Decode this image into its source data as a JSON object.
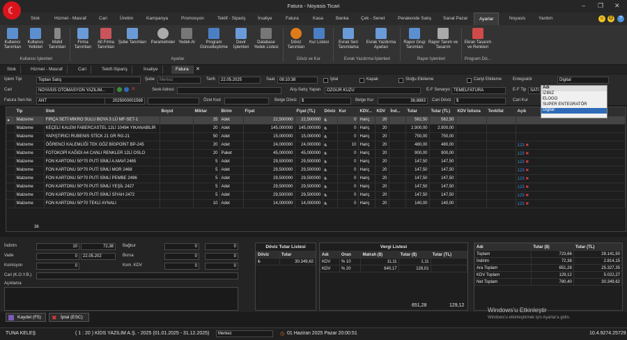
{
  "window": {
    "title": "Fatura - Noyasis Ticari"
  },
  "menu": [
    "Stok",
    "Hizmet - Masraf",
    "Cari",
    "Üretim",
    "Kampanya",
    "Promosyon",
    "Teklif - Sipariş",
    "İrsaliye",
    "Fatura",
    "Kasa",
    "Banka",
    "Çek - Senet",
    "Perakende Satış",
    "Sanal Pazar",
    "Ayarlar",
    "Noyasis",
    "Yardım"
  ],
  "ribbon": {
    "buttons": [
      "Kullanıcı Tanımları",
      "Kullanıcı Yetkileri",
      "Mobil Tanımları",
      "Firma Tanımları",
      "Alt Firma Tanımları",
      "Şube Tanımları",
      "Parametreler",
      "Yedek Al",
      "Program Güncelleştirme",
      "Devir İşlemleri",
      "Database Yedek Listesi",
      "Döviz Tanımları",
      "Kur Listesi",
      "Evrak Seri Tanımlama",
      "Evrak Yazdırma Ayarları",
      "Rapor Grup Tanımları",
      "Rapor Tanım ve Tasarım",
      "Ekran Tasarım ve Renkleri"
    ],
    "groups": [
      "Kullanıcı İşlemleri",
      "Ayarlar",
      "Döviz ve Kur",
      "Evrak Yazdırma İşlemleri",
      "Rapor İşlemleri",
      "Program Diz..."
    ]
  },
  "doc_tabs": [
    "Stok",
    "Hizmet - Masraf",
    "Cari",
    "Teklif-Sipariş",
    "İrsaliye",
    "Fatura"
  ],
  "form": {
    "islem_tipi_label": "İşlem Tipi",
    "islem_tipi": "Toptan Satış",
    "sube_label": "Şube",
    "sube": "Merkez",
    "tarih_label": "Tarih",
    "tarih": "22.05.2025",
    "saat_label": "Saat",
    "saat": "08:10:38",
    "iptal": "İptal",
    "kapak": "Kapak",
    "stoga": "Stoğu Etkileme",
    "cariyi": "Cariyi Etkileme",
    "entegrator_label": "Entegratör",
    "entegrator": "Digital",
    "cari_label": "Cari",
    "cari": "NOYASIS OTOMASYON YAZILIM...",
    "sevk_label": "Sevk Adresi",
    "als_label": "Alış-Satış Yapan",
    "als": "ÖZGÜR KUZU",
    "senaryo_label": "E-F Senaryo",
    "senaryo": "TEMELFATURA",
    "eftip_label": "E-F Tip",
    "eftip": "SATI",
    "seri_label": "Fatura Seri-No",
    "seri": "ANT",
    "no": "2025000001568",
    "ozel_label": "Özel Kod",
    "belge_doviz_label": "Belge Döviz",
    "belge_doviz": "$",
    "belge_kur_label": "Belge Kur",
    "belge_kur": "38,8883",
    "cari_doviz_label": "Cari Döviz",
    "cari_doviz": "$",
    "cari_kur_label": "Cari Kur"
  },
  "dropdown": {
    "header": "Adı",
    "items": [
      "İZIBIZ",
      "ELOGO",
      "SUPER ENTEGRATÖR",
      "Digital"
    ],
    "selected": "Digital"
  },
  "grid": {
    "columns": [
      "Tip",
      "Stok",
      "Boyut",
      "Miktar",
      "Birim",
      "Fiyat",
      "Fiyat (TL)",
      "Döviz",
      "Kur",
      "KDV...",
      "KDV",
      "İnd...",
      "Tutar",
      "Tutar (TL)",
      "KDV İstisna",
      "Tevkifat",
      "Açık"
    ],
    "rows": [
      [
        "Malzeme",
        "FIRÇA SETİ MİKRO SULU BOYA 3 LÜ MF-SET-1",
        "",
        "25",
        "Adet",
        "22,500000",
        "22,500000",
        "₺",
        "0",
        "Hariç",
        "20",
        "",
        "562,50",
        "562,50"
      ],
      [
        "Malzeme",
        "KEÇELİ KALEM FABERCASTEL 12Lİ 10494 YIKANABİLİR",
        "",
        "20",
        "Adet",
        "145,000000",
        "145,000000",
        "₺",
        "0",
        "Hariç",
        "20",
        "",
        "2.900,00",
        "2.900,00"
      ],
      [
        "Malzeme",
        "YAPIŞTIRICI RUBENIS STİCK 21 GR RG-21",
        "",
        "50",
        "Adet",
        "15,000000",
        "15,000000",
        "₺",
        "0",
        "Hariç",
        "20",
        "",
        "750,00",
        "750,00"
      ],
      [
        "Malzeme",
        "ÖĞRENCİ KALEMLİĞİ TEK GÖZ BİGPOİNT BP-245",
        "",
        "20",
        "Adet",
        "24,000000",
        "24,000000",
        "₺",
        "10",
        "Hariç",
        "20",
        "",
        "480,00",
        "480,00"
      ],
      [
        "Malzeme",
        "FOTOKOPİ KAĞIDI A4 CANLI RENKLER 12Lİ OSLO",
        "",
        "20",
        "Paket",
        "45,000000",
        "45,000000",
        "₺",
        "0",
        "Hariç",
        "20",
        "",
        "900,00",
        "900,00"
      ],
      [
        "Malzeme",
        "FON KARTONU 50*70 PUTİ SİMLİ A.MAVİ 2465",
        "",
        "5",
        "Adet",
        "29,500000",
        "29,500000",
        "₺",
        "0",
        "Hariç",
        "20",
        "",
        "147,50",
        "147,50"
      ],
      [
        "Malzeme",
        "FON KARTONU 50*70 PUTİ SİMLİ MOR 2468",
        "",
        "5",
        "Adet",
        "29,500000",
        "29,500000",
        "₺",
        "0",
        "Hariç",
        "20",
        "",
        "147,50",
        "147,50"
      ],
      [
        "Malzeme",
        "FON KARTONU 50*70 PUTİ SİMLİ PEMBE 2496",
        "",
        "5",
        "Adet",
        "29,500000",
        "29,500000",
        "₺",
        "0",
        "Hariç",
        "20",
        "",
        "147,50",
        "147,50"
      ],
      [
        "Malzeme",
        "FON KARTONU 50*70 PUTİ SİMLİ YEŞİL 2427",
        "",
        "5",
        "Adet",
        "29,500000",
        "29,500000",
        "₺",
        "0",
        "Hariç",
        "20",
        "",
        "147,50",
        "147,50"
      ],
      [
        "Malzeme",
        "FON KARTONU 50*70 PUTİ SİMLİ SİYAH 2472",
        "",
        "5",
        "Adet",
        "29,500000",
        "29,500000",
        "₺",
        "0",
        "Hariç",
        "20",
        "",
        "147,50",
        "147,50"
      ],
      [
        "Malzeme",
        "FON KARTONU 50*70 TEKLİ AYNALI",
        "",
        "10",
        "Adet",
        "14,000000",
        "14,000000",
        "₺",
        "0",
        "Hariç",
        "20",
        "",
        "140,00",
        "140,00"
      ]
    ],
    "row_count": "36"
  },
  "bottom": {
    "indirim_label": "İndirim",
    "indirim1": "10",
    "indirim2": "72,38",
    "bagkur_label": "Bağkur",
    "bagkur1": "0",
    "bagkur2": "0",
    "vade_label": "Vade",
    "vade1": "0",
    "vade2": "22.05.202",
    "borsa_label": "Borsa",
    "borsa1": "0",
    "borsa2": "0",
    "komisyon_label": "Komisyon",
    "komisyon1": "0",
    "komkdv_label": "Kom. KDV",
    "komkdv1": "0",
    "komkdv2": "0",
    "carikoys_label": "Cari (K.O.Y.B.)",
    "aciklama_label": "Açıklama"
  },
  "doviz_tutar": {
    "title": "Döviz Tutar Listesi",
    "cols": [
      "Döviz",
      "Tutar"
    ],
    "rows": [
      [
        "₺",
        "30.349,62"
      ]
    ]
  },
  "vergi": {
    "title": "Vergi Listesi",
    "cols": [
      "Adı",
      "Oran",
      "Matrah ($)",
      "Tutar ($)",
      "Tutar (TL)"
    ],
    "rows": [
      [
        "KDV",
        "% 10",
        "11,11",
        "1,11",
        ""
      ],
      [
        "KDV",
        "% 20",
        "640,17",
        "128,01",
        ""
      ]
    ],
    "total_matrah": "651,28",
    "total_tutar": "129,12"
  },
  "totals": {
    "cols": [
      "Adı",
      "Tutar ($)",
      "Tutar (TL)"
    ],
    "rows": [
      [
        "Toplam",
        "723,66",
        "28.141,50"
      ],
      [
        "İndirim",
        "72,38",
        "2.814,15"
      ],
      [
        "Ara Toplam",
        "651,28",
        "25.327,35"
      ],
      [
        "KDV Toplam",
        "129,12",
        "5.022,27"
      ],
      [
        "Net Toplam",
        "780,40",
        "30.349,62"
      ]
    ]
  },
  "actions": {
    "save": "Kaydet (F5)",
    "cancel": "İptal (ESC)"
  },
  "status": {
    "user": "TUNA KELEŞ",
    "company": "( 1 : 20 )  KİDS YAZILIM A.Ş. - 2025  (01.01.2025 - 31.12.2025)",
    "branch": "Merkez",
    "datetime": "01 Haziran 2025 Pazar 20:00:51",
    "version": "10.4.9274.25729"
  },
  "watermark": {
    "line1": "Windows'u Etkinleştir",
    "line2": "Windows'u etkinleştirmek için Ayarlar'a gidin."
  }
}
